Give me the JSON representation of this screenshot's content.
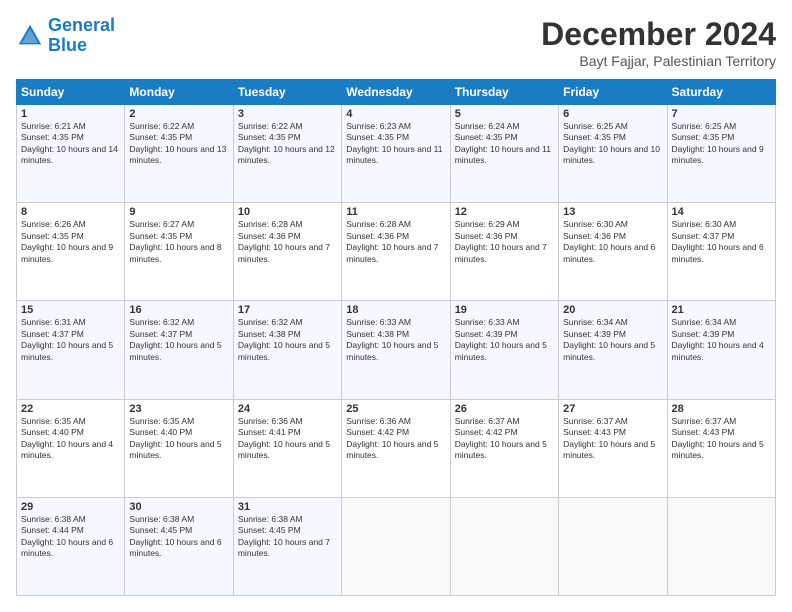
{
  "logo": {
    "line1": "General",
    "line2": "Blue"
  },
  "title": "December 2024",
  "subtitle": "Bayt Fajjar, Palestinian Territory",
  "weekdays": [
    "Sunday",
    "Monday",
    "Tuesday",
    "Wednesday",
    "Thursday",
    "Friday",
    "Saturday"
  ],
  "weeks": [
    [
      {
        "day": "1",
        "sunrise": "6:21 AM",
        "sunset": "4:35 PM",
        "daylight": "10 hours and 14 minutes."
      },
      {
        "day": "2",
        "sunrise": "6:22 AM",
        "sunset": "4:35 PM",
        "daylight": "10 hours and 13 minutes."
      },
      {
        "day": "3",
        "sunrise": "6:22 AM",
        "sunset": "4:35 PM",
        "daylight": "10 hours and 12 minutes."
      },
      {
        "day": "4",
        "sunrise": "6:23 AM",
        "sunset": "4:35 PM",
        "daylight": "10 hours and 11 minutes."
      },
      {
        "day": "5",
        "sunrise": "6:24 AM",
        "sunset": "4:35 PM",
        "daylight": "10 hours and 11 minutes."
      },
      {
        "day": "6",
        "sunrise": "6:25 AM",
        "sunset": "4:35 PM",
        "daylight": "10 hours and 10 minutes."
      },
      {
        "day": "7",
        "sunrise": "6:25 AM",
        "sunset": "4:35 PM",
        "daylight": "10 hours and 9 minutes."
      }
    ],
    [
      {
        "day": "8",
        "sunrise": "6:26 AM",
        "sunset": "4:35 PM",
        "daylight": "10 hours and 9 minutes."
      },
      {
        "day": "9",
        "sunrise": "6:27 AM",
        "sunset": "4:35 PM",
        "daylight": "10 hours and 8 minutes."
      },
      {
        "day": "10",
        "sunrise": "6:28 AM",
        "sunset": "4:36 PM",
        "daylight": "10 hours and 7 minutes."
      },
      {
        "day": "11",
        "sunrise": "6:28 AM",
        "sunset": "4:36 PM",
        "daylight": "10 hours and 7 minutes."
      },
      {
        "day": "12",
        "sunrise": "6:29 AM",
        "sunset": "4:36 PM",
        "daylight": "10 hours and 7 minutes."
      },
      {
        "day": "13",
        "sunrise": "6:30 AM",
        "sunset": "4:36 PM",
        "daylight": "10 hours and 6 minutes."
      },
      {
        "day": "14",
        "sunrise": "6:30 AM",
        "sunset": "4:37 PM",
        "daylight": "10 hours and 6 minutes."
      }
    ],
    [
      {
        "day": "15",
        "sunrise": "6:31 AM",
        "sunset": "4:37 PM",
        "daylight": "10 hours and 5 minutes."
      },
      {
        "day": "16",
        "sunrise": "6:32 AM",
        "sunset": "4:37 PM",
        "daylight": "10 hours and 5 minutes."
      },
      {
        "day": "17",
        "sunrise": "6:32 AM",
        "sunset": "4:38 PM",
        "daylight": "10 hours and 5 minutes."
      },
      {
        "day": "18",
        "sunrise": "6:33 AM",
        "sunset": "4:38 PM",
        "daylight": "10 hours and 5 minutes."
      },
      {
        "day": "19",
        "sunrise": "6:33 AM",
        "sunset": "4:39 PM",
        "daylight": "10 hours and 5 minutes."
      },
      {
        "day": "20",
        "sunrise": "6:34 AM",
        "sunset": "4:39 PM",
        "daylight": "10 hours and 5 minutes."
      },
      {
        "day": "21",
        "sunrise": "6:34 AM",
        "sunset": "4:39 PM",
        "daylight": "10 hours and 4 minutes."
      }
    ],
    [
      {
        "day": "22",
        "sunrise": "6:35 AM",
        "sunset": "4:40 PM",
        "daylight": "10 hours and 4 minutes."
      },
      {
        "day": "23",
        "sunrise": "6:35 AM",
        "sunset": "4:40 PM",
        "daylight": "10 hours and 5 minutes."
      },
      {
        "day": "24",
        "sunrise": "6:36 AM",
        "sunset": "4:41 PM",
        "daylight": "10 hours and 5 minutes."
      },
      {
        "day": "25",
        "sunrise": "6:36 AM",
        "sunset": "4:42 PM",
        "daylight": "10 hours and 5 minutes."
      },
      {
        "day": "26",
        "sunrise": "6:37 AM",
        "sunset": "4:42 PM",
        "daylight": "10 hours and 5 minutes."
      },
      {
        "day": "27",
        "sunrise": "6:37 AM",
        "sunset": "4:43 PM",
        "daylight": "10 hours and 5 minutes."
      },
      {
        "day": "28",
        "sunrise": "6:37 AM",
        "sunset": "4:43 PM",
        "daylight": "10 hours and 5 minutes."
      }
    ],
    [
      {
        "day": "29",
        "sunrise": "6:38 AM",
        "sunset": "4:44 PM",
        "daylight": "10 hours and 6 minutes."
      },
      {
        "day": "30",
        "sunrise": "6:38 AM",
        "sunset": "4:45 PM",
        "daylight": "10 hours and 6 minutes."
      },
      {
        "day": "31",
        "sunrise": "6:38 AM",
        "sunset": "4:45 PM",
        "daylight": "10 hours and 7 minutes."
      },
      null,
      null,
      null,
      null
    ]
  ]
}
